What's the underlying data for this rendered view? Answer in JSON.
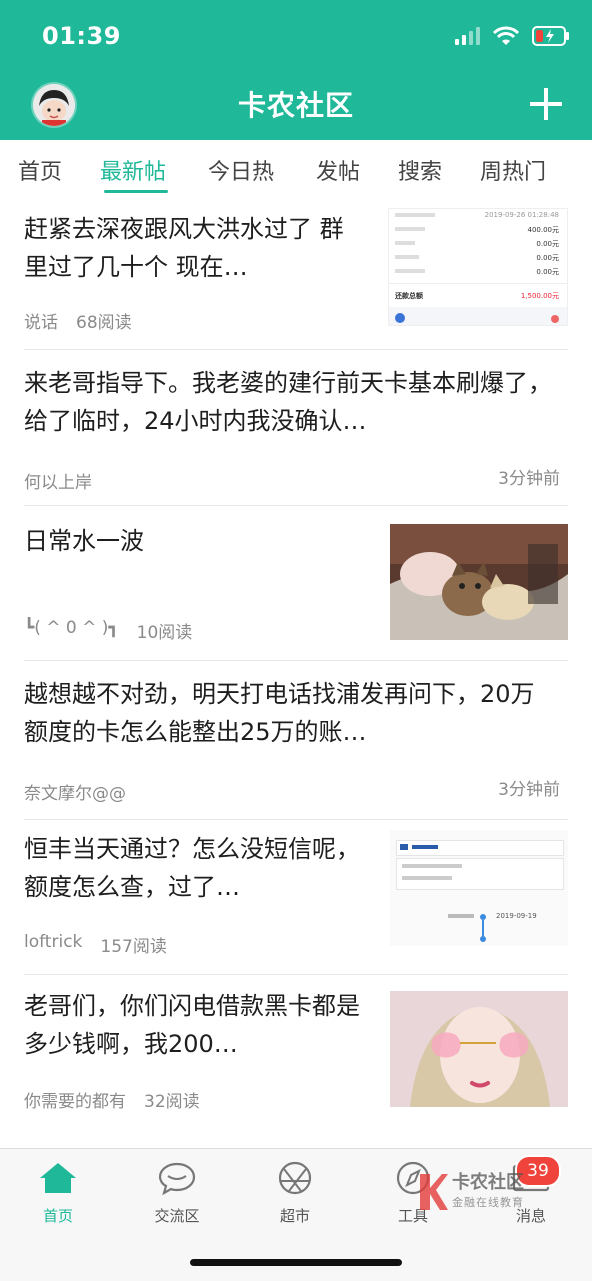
{
  "status": {
    "time": "01:39"
  },
  "header": {
    "title": "卡农社区",
    "avatar_icon": "cartoon-avatar",
    "plus_icon": "plus-icon"
  },
  "tabs": [
    {
      "label": "首页"
    },
    {
      "label": "最新帖",
      "active": true
    },
    {
      "label": "今日热"
    },
    {
      "label": "发帖"
    },
    {
      "label": "搜索"
    },
    {
      "label": "周热门"
    }
  ],
  "posts": [
    {
      "title": "赶紧去深夜跟风大洪水过了 群里过了几十个 现在…",
      "author": "说话",
      "reads": "68阅读",
      "time": "",
      "thumb": {
        "type": "receipt",
        "rows": [
          [
            "2019-09-26 01:28:48"
          ],
          [
            "400.00元"
          ],
          [
            "0.00元"
          ],
          [
            "0.00元"
          ],
          [
            "0.00元"
          ]
        ],
        "total_label": "还款总额",
        "total": "1,500.00元"
      }
    },
    {
      "title": "来老哥指导下。我老婆的建行前天卡基本刷爆了，给了临时，24小时内我没确认…",
      "author": "何以上岸",
      "reads": "",
      "time": "3分钟前"
    },
    {
      "title": "日常水一波",
      "author": "┗( ^ 0 ^ )┓",
      "reads": "10阅读",
      "time": "",
      "thumb": {
        "type": "cat-photo"
      }
    },
    {
      "title": "越想越不对劲，明天打电话找浦发再问下，20万额度的卡怎么能整出25万的账…",
      "author": "奈文摩尔@@",
      "reads": "",
      "time": "3分钟前"
    },
    {
      "title": "恒丰当天通过？怎么没短信呢，额度怎么查，过了…",
      "author": "loftrick",
      "reads": "157阅读",
      "time": "",
      "thumb": {
        "type": "bank-screen",
        "date": "2019-09-19"
      }
    },
    {
      "title": "老哥们，你们闪电借款黑卡都是多少钱啊，我200…",
      "author": "你需要的都有",
      "reads": "32阅读",
      "time": "",
      "thumb": {
        "type": "selfie-photo"
      }
    }
  ],
  "bottom_nav": [
    {
      "label": "首页",
      "icon": "home-icon",
      "active": true
    },
    {
      "label": "交流区",
      "icon": "chat-bubble-icon"
    },
    {
      "label": "超市",
      "icon": "aperture-icon"
    },
    {
      "label": "工具",
      "icon": "compass-icon"
    },
    {
      "label": "消息",
      "icon": "mail-icon",
      "badge": "39"
    }
  ],
  "watermark": {
    "line1": "卡农社区",
    "line2": "金融在线教育"
  },
  "colors": {
    "accent": "#1fb899",
    "badge": "#f0433b"
  }
}
